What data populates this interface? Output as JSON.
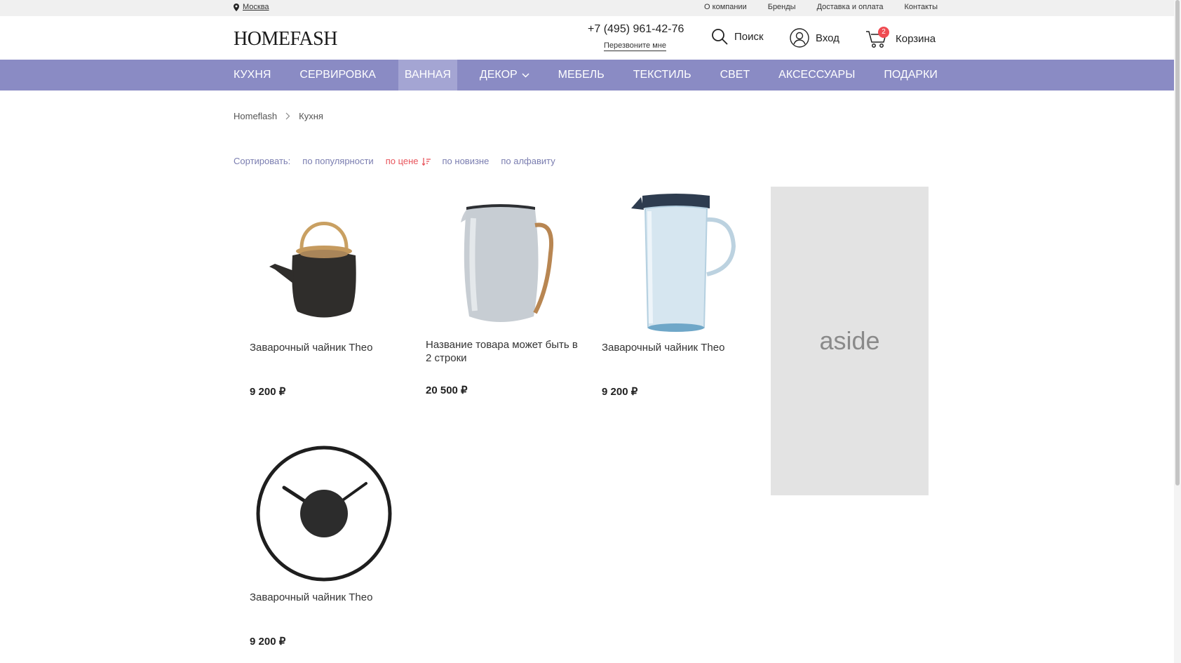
{
  "topbar": {
    "city": "Москва",
    "links": [
      "О компании",
      "Бренды",
      "Доставка и оплата",
      "Контакты"
    ]
  },
  "header": {
    "logo": "HOMEFASH",
    "phone": "+7 (495) 961-42-76",
    "callback": "Перезвоните мне",
    "search_label": "Поиск",
    "login_label": "Вход",
    "cart_label": "Корзина",
    "cart_count": "2"
  },
  "nav": {
    "items": [
      "КУХНЯ",
      "СЕРВИРОВКА",
      "ВАННАЯ",
      "ДЕКОР",
      "МЕБЕЛЬ",
      "ТЕКСТИЛЬ",
      "СВЕТ",
      "АКСЕССУАРЫ",
      "ПОДАРКИ"
    ],
    "active": "ВАННАЯ"
  },
  "breadcrumb": {
    "home": "Homeflash",
    "current": "Кухня"
  },
  "sort": {
    "label": "Сортировать:",
    "options": [
      "по популярности",
      "по цене",
      "по новизне",
      "по алфавиту"
    ],
    "active": "по цене"
  },
  "products": [
    {
      "name": "Заварочный чайник Theo",
      "price": "9 200 ₽",
      "icon": "teapot-image"
    },
    {
      "name": "Название товара может быть в 2 строки",
      "price": "20 500 ₽",
      "icon": "kettle-image"
    },
    {
      "name": "Заварочный чайник Theo",
      "price": "9 200 ₽",
      "icon": "jug-image"
    },
    {
      "name": "Заварочный чайник Theo",
      "price": "9 200 ₽",
      "icon": "clock-image"
    }
  ],
  "aside": {
    "label": "aside"
  },
  "colors": {
    "nav_bg": "#8a8bc4",
    "nav_active": "#a4a5d3",
    "sort_link": "#7a7db0",
    "sort_active": "#e8555c",
    "cart_badge": "#ef4b52"
  }
}
